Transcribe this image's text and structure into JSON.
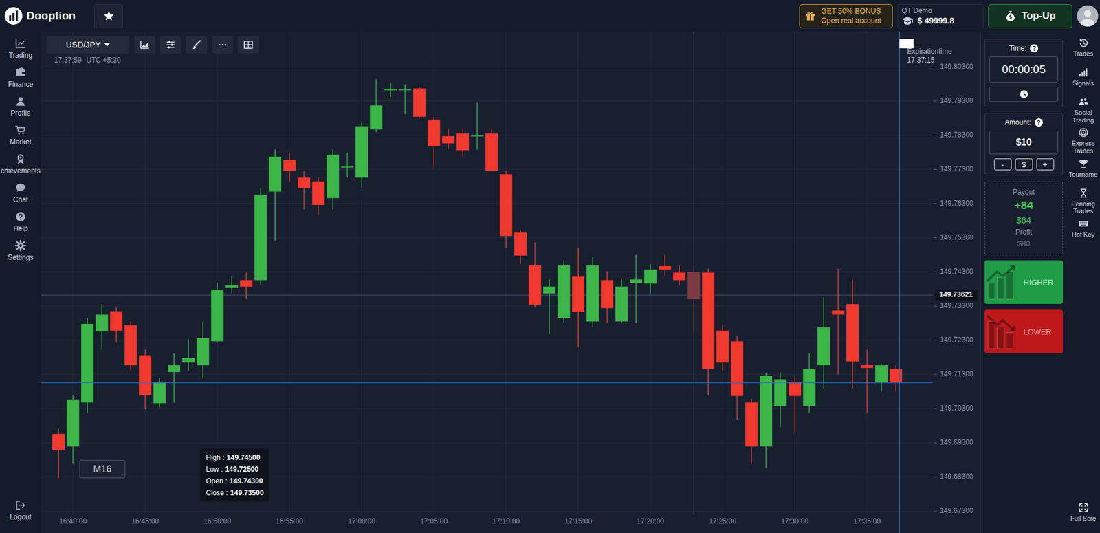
{
  "top_bar": {
    "logo": "Dooption",
    "bonus": {
      "title": "GET 50% BONUS",
      "subtitle": "Open real account"
    },
    "account": {
      "label": "QT Demo",
      "balance": "$ 49999.8"
    },
    "top_up": "Top-Up"
  },
  "left_nav": {
    "items": [
      "Trading",
      "Finance",
      "Profile",
      "Market",
      "chievements",
      "Chat",
      "Help",
      "Settings"
    ],
    "logout": "Logout"
  },
  "right_nav": {
    "items": [
      "Trades",
      "Signals",
      "Social Trading",
      "Express Trades",
      "Tourname",
      "Pending Trades",
      "Hot Key"
    ],
    "full_screen": "Full Scre"
  },
  "chart": {
    "symbol": "USD/JPY",
    "clock": "17:37:59",
    "timezone": "UTC +5:30",
    "timeframe": "M16",
    "expiration": {
      "label": "Expirationtime",
      "time": "17:37:15"
    },
    "crosshair_price": "149.73621",
    "tooltip": [
      {
        "label": "High :",
        "value": "149.74500"
      },
      {
        "label": "Low :",
        "value": "149.72500"
      },
      {
        "label": "Open :",
        "value": "149.74300"
      },
      {
        "label": "Close :",
        "value": "149.73500"
      }
    ],
    "y_ticks": [
      "149.80300",
      "149.79300",
      "149.78300",
      "149.77300",
      "149.76300",
      "149.75300",
      "149.74300",
      "149.73300",
      "149.72300",
      "149.71300",
      "149.70300",
      "149.69300",
      "149.68300",
      "149.67300"
    ],
    "x_ticks": [
      "16:40:00",
      "16:45:00",
      "16:50:00",
      "16:55:00",
      "17:00:00",
      "17:05:00",
      "17:10:00",
      "17:15:00",
      "17:20:00",
      "17:25:00",
      "17:30:00",
      "17:35:00"
    ],
    "candles": [
      {
        "o": 149.6956,
        "h": 149.6972,
        "l": 149.6827,
        "c": 149.6909,
        "hovered": false
      },
      {
        "o": 149.6919,
        "h": 149.7069,
        "l": 149.687,
        "c": 149.7057,
        "hovered": false
      },
      {
        "o": 149.7048,
        "h": 149.7295,
        "l": 149.7018,
        "c": 149.7278,
        "hovered": false
      },
      {
        "o": 149.7256,
        "h": 149.7336,
        "l": 149.7202,
        "c": 149.7305,
        "hovered": false
      },
      {
        "o": 149.7315,
        "h": 149.7326,
        "l": 149.7223,
        "c": 149.7258,
        "hovered": false
      },
      {
        "o": 149.7274,
        "h": 149.7285,
        "l": 149.7141,
        "c": 149.7157,
        "hovered": false
      },
      {
        "o": 149.7186,
        "h": 149.7202,
        "l": 149.7028,
        "c": 149.7069,
        "hovered": false
      },
      {
        "o": 149.7046,
        "h": 149.712,
        "l": 149.7034,
        "c": 149.7106,
        "hovered": false
      },
      {
        "o": 149.7137,
        "h": 149.7192,
        "l": 149.7048,
        "c": 149.7157,
        "hovered": false
      },
      {
        "o": 149.7165,
        "h": 149.7233,
        "l": 149.7141,
        "c": 149.7178,
        "hovered": false
      },
      {
        "o": 149.7157,
        "h": 149.7285,
        "l": 149.712,
        "c": 149.7237,
        "hovered": false
      },
      {
        "o": 149.7227,
        "h": 149.7398,
        "l": 149.7223,
        "c": 149.7377,
        "hovered": false
      },
      {
        "o": 149.7383,
        "h": 149.7418,
        "l": 149.7367,
        "c": 149.7391,
        "hovered": false
      },
      {
        "o": 149.7406,
        "h": 149.7428,
        "l": 149.735,
        "c": 149.7387,
        "hovered": false
      },
      {
        "o": 149.7406,
        "h": 149.7675,
        "l": 149.7391,
        "c": 149.7656,
        "hovered": false
      },
      {
        "o": 149.7665,
        "h": 149.7788,
        "l": 149.7521,
        "c": 149.7767,
        "hovered": false
      },
      {
        "o": 149.7757,
        "h": 149.7778,
        "l": 149.7695,
        "c": 149.7726,
        "hovered": false
      },
      {
        "o": 149.7706,
        "h": 149.7726,
        "l": 149.7613,
        "c": 149.7675,
        "hovered": false
      },
      {
        "o": 149.7695,
        "h": 149.7706,
        "l": 149.7597,
        "c": 149.7626,
        "hovered": false
      },
      {
        "o": 149.7646,
        "h": 149.7788,
        "l": 149.7613,
        "c": 149.7773,
        "hovered": false
      },
      {
        "o": 149.7736,
        "h": 149.7778,
        "l": 149.7706,
        "c": 149.7738,
        "hovered": false
      },
      {
        "o": 149.7706,
        "h": 149.787,
        "l": 149.7675,
        "c": 149.7856,
        "hovered": false
      },
      {
        "o": 149.7847,
        "h": 149.7993,
        "l": 149.7839,
        "c": 149.7917,
        "hovered": false
      },
      {
        "o": 149.7962,
        "h": 149.7983,
        "l": 149.7942,
        "c": 149.7964,
        "hovered": false
      },
      {
        "o": 149.7962,
        "h": 149.7979,
        "l": 149.7891,
        "c": 149.7964,
        "hovered": false
      },
      {
        "o": 149.7967,
        "h": 149.7971,
        "l": 149.788,
        "c": 149.7884,
        "hovered": false
      },
      {
        "o": 149.7876,
        "h": 149.7884,
        "l": 149.7736,
        "c": 149.7798,
        "hovered": false
      },
      {
        "o": 149.7827,
        "h": 149.7849,
        "l": 149.7788,
        "c": 149.7806,
        "hovered": false
      },
      {
        "o": 149.7835,
        "h": 149.7849,
        "l": 149.7767,
        "c": 149.7786,
        "hovered": false
      },
      {
        "o": 149.7827,
        "h": 149.7925,
        "l": 149.7788,
        "c": 149.7829,
        "hovered": false
      },
      {
        "o": 149.7835,
        "h": 149.7849,
        "l": 149.7726,
        "c": 149.7726,
        "hovered": false
      },
      {
        "o": 149.7716,
        "h": 149.7726,
        "l": 149.75,
        "c": 149.7535,
        "hovered": false
      },
      {
        "o": 149.7545,
        "h": 149.7552,
        "l": 149.7453,
        "c": 149.7478,
        "hovered": false
      },
      {
        "o": 149.7449,
        "h": 149.7516,
        "l": 149.7326,
        "c": 149.7334,
        "hovered": false
      },
      {
        "o": 149.7367,
        "h": 149.7408,
        "l": 149.7248,
        "c": 149.7387,
        "hovered": false
      },
      {
        "o": 149.7295,
        "h": 149.7465,
        "l": 149.7281,
        "c": 149.7449,
        "hovered": false
      },
      {
        "o": 149.7416,
        "h": 149.75,
        "l": 149.7209,
        "c": 149.7313,
        "hovered": false
      },
      {
        "o": 149.7285,
        "h": 149.7474,
        "l": 149.7268,
        "c": 149.7449,
        "hovered": false
      },
      {
        "o": 149.7406,
        "h": 149.7432,
        "l": 149.7281,
        "c": 149.7324,
        "hovered": false
      },
      {
        "o": 149.7285,
        "h": 149.7408,
        "l": 149.7281,
        "c": 149.7387,
        "hovered": false
      },
      {
        "o": 149.7398,
        "h": 149.748,
        "l": 149.7281,
        "c": 149.7408,
        "hovered": false
      },
      {
        "o": 149.7396,
        "h": 149.7453,
        "l": 149.7367,
        "c": 149.7437,
        "hovered": false
      },
      {
        "o": 149.7447,
        "h": 149.748,
        "l": 149.7418,
        "c": 149.7437,
        "hovered": false
      },
      {
        "o": 149.7428,
        "h": 149.7449,
        "l": 149.7391,
        "c": 149.7406,
        "hovered": false
      },
      {
        "o": 149.743,
        "h": 149.745,
        "l": 149.725,
        "c": 149.735,
        "hovered": true
      },
      {
        "o": 149.7428,
        "h": 149.7439,
        "l": 149.7069,
        "c": 149.7147,
        "hovered": false
      },
      {
        "o": 149.7258,
        "h": 149.7274,
        "l": 149.7141,
        "c": 149.7165,
        "hovered": false
      },
      {
        "o": 149.7227,
        "h": 149.7244,
        "l": 149.6997,
        "c": 149.7067,
        "hovered": false
      },
      {
        "o": 149.7048,
        "h": 149.7059,
        "l": 149.687,
        "c": 149.6919,
        "hovered": false
      },
      {
        "o": 149.6919,
        "h": 149.7135,
        "l": 149.6857,
        "c": 149.7126,
        "hovered": false
      },
      {
        "o": 149.7038,
        "h": 149.7137,
        "l": 149.6976,
        "c": 149.7116,
        "hovered": false
      },
      {
        "o": 149.7106,
        "h": 149.7128,
        "l": 149.696,
        "c": 149.7067,
        "hovered": false
      },
      {
        "o": 149.7038,
        "h": 149.7192,
        "l": 149.7018,
        "c": 149.7147,
        "hovered": false
      },
      {
        "o": 149.7157,
        "h": 149.7356,
        "l": 149.7089,
        "c": 149.7268,
        "hovered": false
      },
      {
        "o": 149.7317,
        "h": 149.7439,
        "l": 149.713,
        "c": 149.7305,
        "hovered": false
      },
      {
        "o": 149.7336,
        "h": 149.7408,
        "l": 149.7089,
        "c": 149.7168,
        "hovered": false
      },
      {
        "o": 149.7157,
        "h": 149.7202,
        "l": 149.7018,
        "c": 149.7149,
        "hovered": false
      },
      {
        "o": 149.7106,
        "h": 149.7161,
        "l": 149.7079,
        "c": 149.7157,
        "hovered": false
      },
      {
        "o": 149.7147,
        "h": 149.7157,
        "l": 149.7079,
        "c": 149.7106,
        "hovered": false
      }
    ]
  },
  "trade_panel": {
    "time": {
      "label": "Time:",
      "help": "?",
      "value": "00:00:05"
    },
    "amount": {
      "label": "Amount:",
      "help": "?",
      "value": "$10",
      "buttons": [
        "-",
        "$",
        "+"
      ]
    },
    "payout": {
      "label": "Payout",
      "percent": "+84",
      "value": "$64",
      "profit_label": "Profit",
      "profit": "$80"
    },
    "higher": "HIGHER",
    "lower": "LOWER"
  }
}
